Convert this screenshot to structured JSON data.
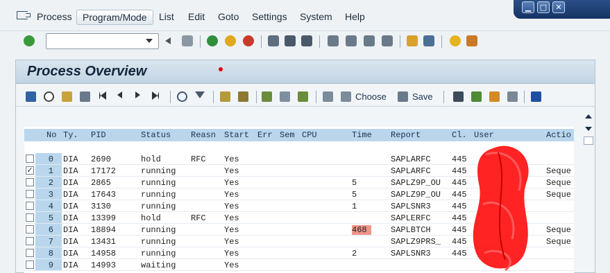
{
  "menubar": {
    "items": [
      "Process",
      "Program/Mode",
      "List",
      "Edit",
      "Goto",
      "Settings",
      "System",
      "Help"
    ]
  },
  "window_controls": {
    "minimize": "▁",
    "maximize": "□",
    "close": "✕"
  },
  "toolbar": {
    "command_field_value": "",
    "icons": [
      "enter-icon",
      "back-icon",
      "save-icon",
      "exit-icon",
      "cancel-icon",
      "print-icon",
      "find-icon",
      "find-next-icon",
      "first-page-icon",
      "prev-page-icon",
      "next-page-icon",
      "last-page-icon",
      "new-session-icon",
      "shortcut-icon",
      "help-icon",
      "layout-icon"
    ]
  },
  "page": {
    "title": "Process Overview",
    "app_toolbar": {
      "choose_label": "Choose",
      "save_label": "Save"
    }
  },
  "table": {
    "columns": [
      "No",
      "Ty.",
      "PID",
      "Status",
      "Reasn",
      "Start",
      "Err",
      "Sem",
      "CPU",
      "Time",
      "Report",
      "Cl.",
      "User",
      "Actio"
    ],
    "rows": [
      {
        "no": "0",
        "ty": "DIA",
        "pid": "2690",
        "status": "hold",
        "reasn": "RFC",
        "start": "Yes",
        "time": "",
        "report": "SAPLARFC",
        "cl": "445",
        "action": "",
        "checked": false
      },
      {
        "no": "1",
        "ty": "DIA",
        "pid": "17172",
        "status": "running",
        "reasn": "",
        "start": "Yes",
        "time": "",
        "report": "SAPLARFC",
        "cl": "445",
        "action": "Seque",
        "checked": true
      },
      {
        "no": "2",
        "ty": "DIA",
        "pid": "2865",
        "status": "running",
        "reasn": "",
        "start": "Yes",
        "time": "5",
        "report": "SAPLZ9P_OU",
        "cl": "445",
        "action": "Seque",
        "checked": false
      },
      {
        "no": "3",
        "ty": "DIA",
        "pid": "17643",
        "status": "running",
        "reasn": "",
        "start": "Yes",
        "time": "5",
        "report": "SAPLZ9P_OU",
        "cl": "445",
        "action": "Seque",
        "checked": false
      },
      {
        "no": "4",
        "ty": "DIA",
        "pid": "3130",
        "status": "running",
        "reasn": "",
        "start": "Yes",
        "time": "1",
        "report": "SAPLSNR3",
        "cl": "445",
        "action": "",
        "checked": false
      },
      {
        "no": "5",
        "ty": "DIA",
        "pid": "13399",
        "status": "hold",
        "reasn": "RFC",
        "start": "Yes",
        "time": "",
        "report": "SAPLERFC",
        "cl": "445",
        "action": "",
        "checked": false
      },
      {
        "no": "6",
        "ty": "DIA",
        "pid": "18894",
        "status": "running",
        "reasn": "",
        "start": "Yes",
        "time": "468",
        "report": "SAPLBTCH",
        "cl": "445",
        "action": "Seque",
        "checked": false,
        "time_highlight": true
      },
      {
        "no": "7",
        "ty": "DIA",
        "pid": "13431",
        "status": "running",
        "reasn": "",
        "start": "Yes",
        "time": "",
        "report": "SAPLZ9PRS_",
        "cl": "445",
        "action": "Seque",
        "checked": false
      },
      {
        "no": "8",
        "ty": "DIA",
        "pid": "14958",
        "status": "running",
        "reasn": "",
        "start": "Yes",
        "time": "2",
        "report": "SAPLSNR3",
        "cl": "445",
        "action": "",
        "checked": false
      },
      {
        "no": "9",
        "ty": "DIA",
        "pid": "14993",
        "status": "waiting",
        "reasn": "",
        "start": "Yes",
        "time": "",
        "report": "",
        "cl": "",
        "action": "",
        "checked": false
      }
    ]
  },
  "colors": {
    "header_band": "#b9d6ec",
    "title_bar": "#c9d9e7",
    "highlight_time": "#f0958a",
    "redaction": "#ff0000"
  }
}
